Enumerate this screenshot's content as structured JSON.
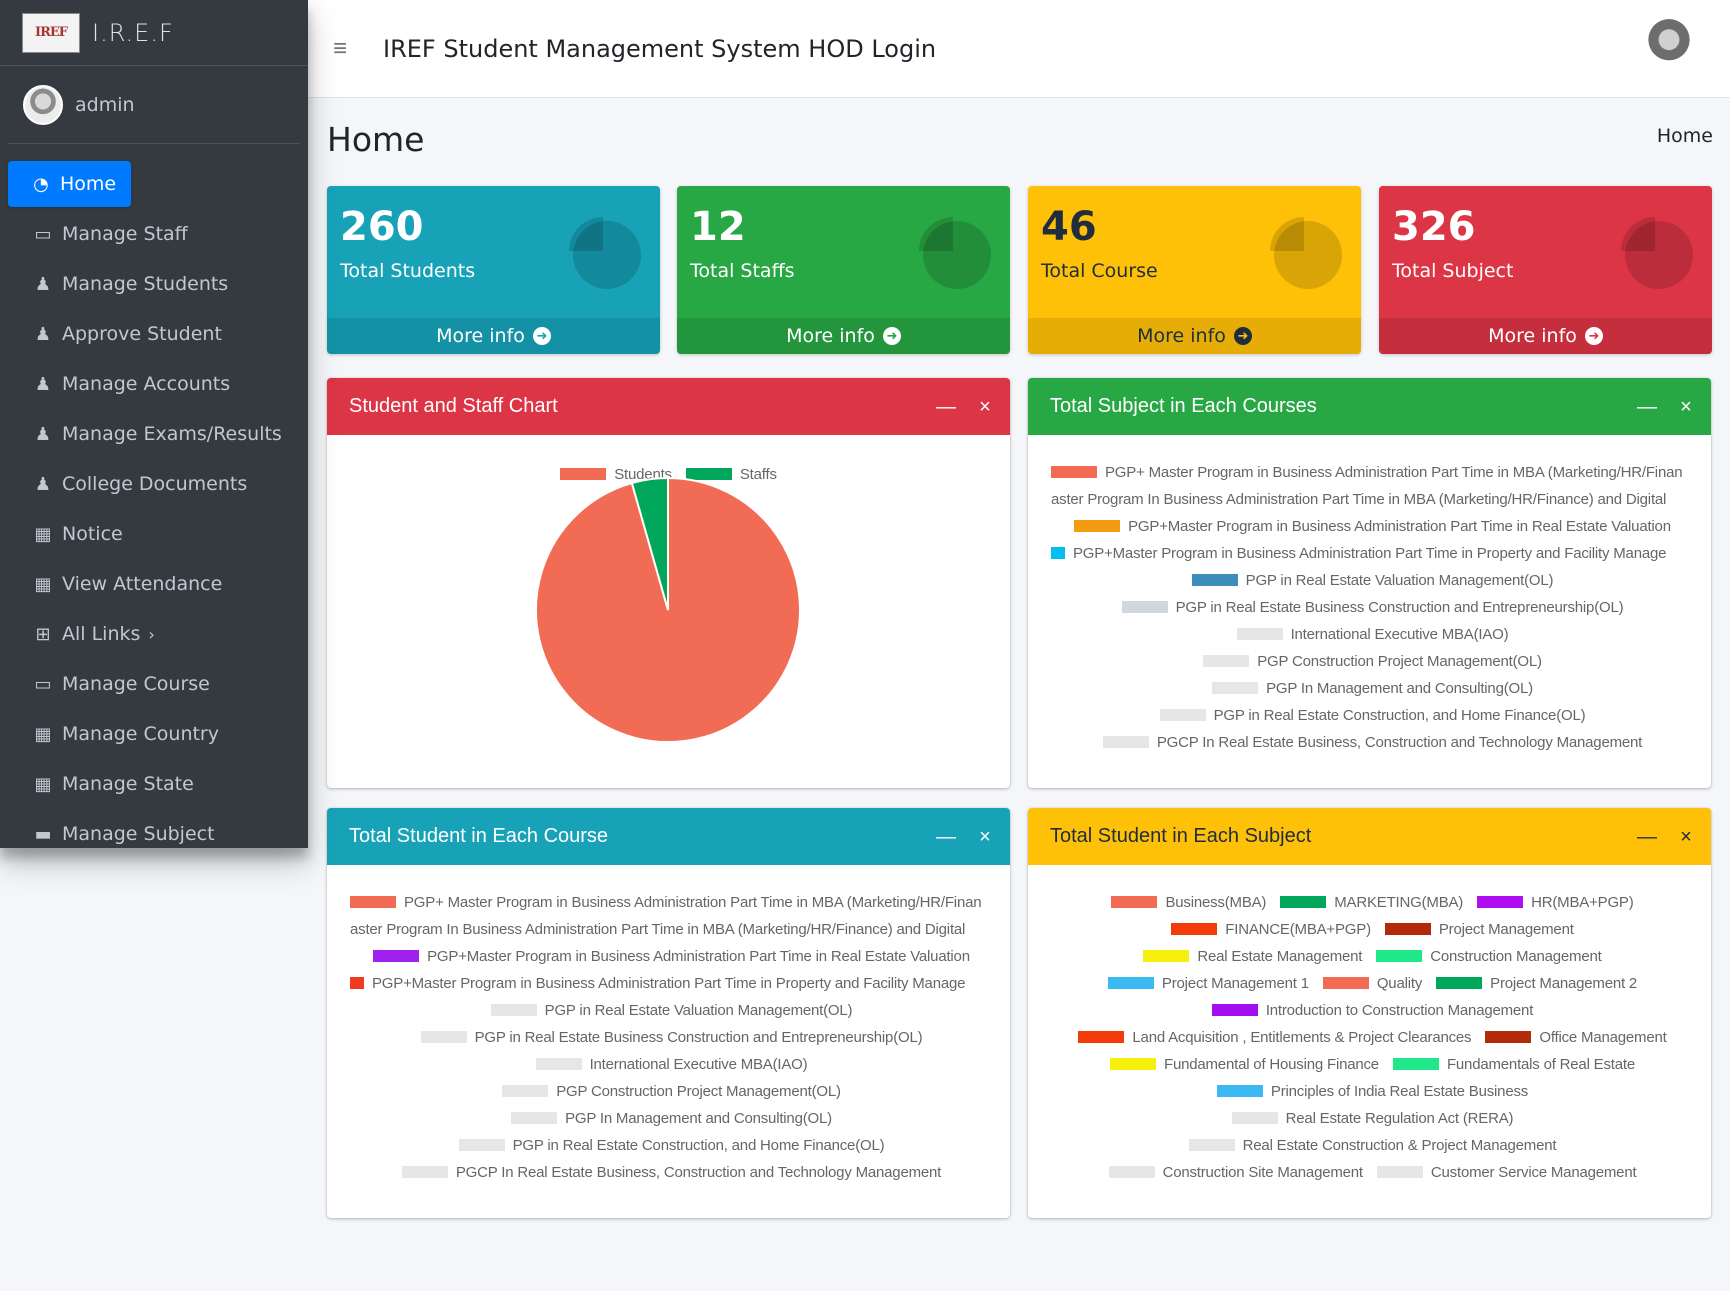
{
  "brand": {
    "name": "I.R.E.F",
    "logo_text": "IREF"
  },
  "user": {
    "name": "admin"
  },
  "sidebar": {
    "items": [
      {
        "label": "Home",
        "icon": "dashboard-icon"
      },
      {
        "label": "Manage Staff",
        "icon": "staff-icon"
      },
      {
        "label": "Manage Students",
        "icon": "user-graduate-icon"
      },
      {
        "label": "Approve Student",
        "icon": "user-graduate-icon"
      },
      {
        "label": "Manage Accounts",
        "icon": "user-graduate-icon"
      },
      {
        "label": "Manage Exams/Results",
        "icon": "user-graduate-icon"
      },
      {
        "label": "College Documents",
        "icon": "user-graduate-icon"
      },
      {
        "label": "Notice",
        "icon": "grid-icon"
      },
      {
        "label": "View Attendance",
        "icon": "grid-icon"
      },
      {
        "label": "All Links",
        "icon": "table-icon"
      },
      {
        "label": "Manage Course",
        "icon": "laptop-icon"
      },
      {
        "label": "Manage Country",
        "icon": "grid-icon"
      },
      {
        "label": "Manage State",
        "icon": "grid-icon"
      },
      {
        "label": "Manage Subject",
        "icon": "book-icon"
      }
    ]
  },
  "header": {
    "title": "IREF Student Management System HOD Login"
  },
  "page": {
    "title": "Home",
    "breadcrumb": "Home"
  },
  "stats": [
    {
      "value": "260",
      "label": "Total Students",
      "more": "More info",
      "color": "#17a2b8"
    },
    {
      "value": "12",
      "label": "Total Staffs",
      "more": "More info",
      "color": "#28a745"
    },
    {
      "value": "46",
      "label": "Total Course",
      "more": "More info",
      "color": "#ffc107"
    },
    {
      "value": "326",
      "label": "Total Subject",
      "more": "More info",
      "color": "#dc3545"
    }
  ],
  "cards": {
    "student_staff": {
      "title": "Student and Staff Chart",
      "color": "#dc3545"
    },
    "subject_courses": {
      "title": "Total Subject in Each Courses",
      "color": "#28a745"
    },
    "student_course": {
      "title": "Total Student in Each Course",
      "color": "#17a2b8"
    },
    "student_subject": {
      "title": "Total Student in Each Subject",
      "color": "#ffc107"
    },
    "minimize_glyph": "—",
    "close_glyph": "×"
  },
  "chart_data": [
    {
      "type": "pie",
      "title": "",
      "categories": [
        "Students",
        "Staffs"
      ],
      "values": [
        260,
        12
      ],
      "colors": [
        "#f26b55",
        "#00a65a"
      ]
    },
    {
      "type": "pie",
      "title": "",
      "legend_lines": [
        [
          {
            "label": "PGP+ Master Program in Business Administration Part Time in MBA (Marketing/HR/Finan",
            "color": "#f26b55"
          }
        ],
        [
          {
            "label": "aster Program In Business Administration Part Time in MBA (Marketing/HR/Finance) and Digital",
            "color": ""
          }
        ],
        [
          {
            "label": "PGP+Master Program in Business Administration Part Time  in Real Estate Valuation",
            "color": "#f39c12"
          }
        ],
        [
          {
            "label": "PGP+Master Program in Business Administration Part Time in Property and Facility Manage",
            "color": "#00c0ef",
            "short": true
          }
        ],
        [
          {
            "label": "PGP in Real Estate Valuation Management(OL)",
            "color": "#3c8dbc"
          }
        ],
        [
          {
            "label": "PGP in Real Estate Business Construction and Entrepreneurship(OL)",
            "color": "#d2d6de"
          }
        ],
        [
          {
            "label": "International Executive MBA(IAO)",
            "color": "#e6e6e6"
          }
        ],
        [
          {
            "label": "PGP Construction Project Management(OL)",
            "color": "#e6e6e6"
          }
        ],
        [
          {
            "label": "PGP In Management and Consulting(OL)",
            "color": "#e6e6e6"
          }
        ],
        [
          {
            "label": "PGP in Real Estate Construction, and Home Finance(OL)",
            "color": "#e6e6e6"
          }
        ],
        [
          {
            "label": "PGCP In Real Estate Business, Construction and Technology Management",
            "color": "#e6e6e6"
          }
        ]
      ]
    },
    {
      "type": "pie",
      "title": "",
      "legend_lines": [
        [
          {
            "label": "PGP+ Master Program in Business Administration Part Time in MBA (Marketing/HR/Finan",
            "color": "#f26b55"
          }
        ],
        [
          {
            "label": "aster Program In Business Administration Part Time in MBA (Marketing/HR/Finance) and Digital",
            "color": ""
          }
        ],
        [
          {
            "label": "PGP+Master Program in Business Administration Part Time  in Real Estate Valuation",
            "color": "#a020f0"
          }
        ],
        [
          {
            "label": "PGP+Master Program in Business Administration Part Time in Property and Facility Manage",
            "color": "#f03c1e",
            "short": true
          }
        ],
        [
          {
            "label": "PGP in Real Estate Valuation Management(OL)",
            "color": "#e6e6e6"
          }
        ],
        [
          {
            "label": "PGP in Real Estate Business Construction and Entrepreneurship(OL)",
            "color": "#e6e6e6"
          }
        ],
        [
          {
            "label": "International Executive MBA(IAO)",
            "color": "#e6e6e6"
          }
        ],
        [
          {
            "label": "PGP Construction Project Management(OL)",
            "color": "#e6e6e6"
          }
        ],
        [
          {
            "label": "PGP In Management and Consulting(OL)",
            "color": "#e6e6e6"
          }
        ],
        [
          {
            "label": "PGP in Real Estate Construction, and Home Finance(OL)",
            "color": "#e6e6e6"
          }
        ],
        [
          {
            "label": "PGCP In Real Estate Business, Construction and Technology Management",
            "color": "#e6e6e6"
          }
        ]
      ]
    },
    {
      "type": "pie",
      "title": "",
      "legend_lines": [
        [
          {
            "label": "Business(MBA)",
            "color": "#f26b55"
          },
          {
            "label": "MARKETING(MBA)",
            "color": "#00a65a"
          },
          {
            "label": "HR(MBA+PGP)",
            "color": "#b00ef0"
          }
        ],
        [
          {
            "label": "FINANCE(MBA+PGP)",
            "color": "#f23c0a"
          },
          {
            "label": "Project Management",
            "color": "#b22a0a"
          }
        ],
        [
          {
            "label": "Real Estate Management",
            "color": "#f5f10a"
          },
          {
            "label": "Construction Management",
            "color": "#1ee88a"
          }
        ],
        [
          {
            "label": "Project Management  1",
            "color": "#3cb8f2"
          },
          {
            "label": "Quality",
            "color": "#f26b55"
          },
          {
            "label": "Project Management  2",
            "color": "#00a65a"
          }
        ],
        [
          {
            "label": "Introduction to Construction Management",
            "color": "#a20ef0"
          }
        ],
        [
          {
            "label": "Land Acquisition , Entitlements & Project Clearances",
            "color": "#f23c0a"
          },
          {
            "label": "Office Management",
            "color": "#b22a0a"
          }
        ],
        [
          {
            "label": "Fundamental of Housing Finance",
            "color": "#f5f10a"
          },
          {
            "label": "Fundamentals of Real Estate",
            "color": "#1ee88a"
          }
        ],
        [
          {
            "label": "Principles of India Real Estate Business",
            "color": "#3cb8f2"
          }
        ],
        [
          {
            "label": "Real Estate Regulation Act (RERA)",
            "color": "#e6e6e6"
          }
        ],
        [
          {
            "label": "Real Estate Construction & Project Management",
            "color": "#e6e6e6"
          }
        ],
        [
          {
            "label": "Construction Site Management",
            "color": "#e6e6e6"
          },
          {
            "label": "Customer Service Management",
            "color": "#e6e6e6"
          }
        ]
      ]
    }
  ]
}
